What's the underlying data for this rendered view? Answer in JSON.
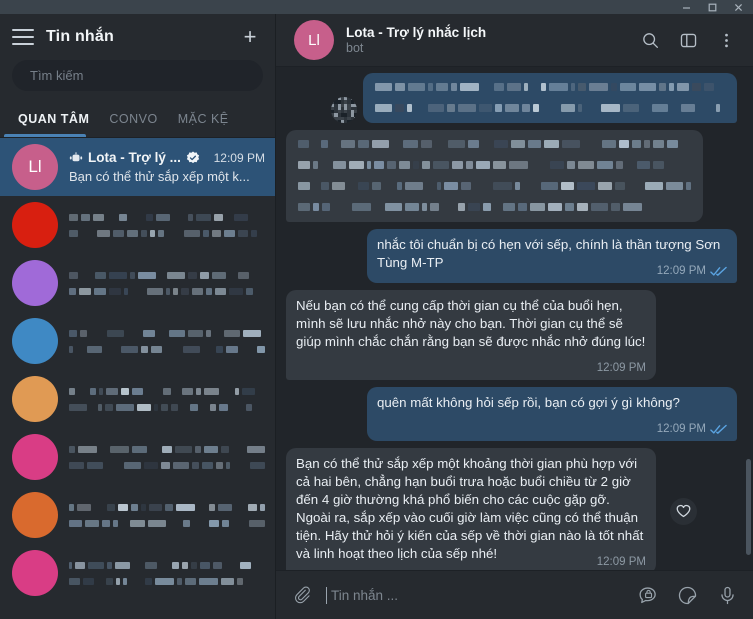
{
  "window": {
    "controls": [
      {
        "name": "minimize",
        "glyph": "minimize-icon"
      },
      {
        "name": "maximize",
        "glyph": "maximize-icon"
      },
      {
        "name": "close",
        "glyph": "close-icon"
      }
    ]
  },
  "colors": {
    "accent_blue": "#4a82b5",
    "selected_row": "#2d5377",
    "bubble_out": "#2d4a66",
    "bubble_in": "#343a41",
    "avatar_pink": "#c75f8b",
    "ticks_blue": "#5aa3e0",
    "sidebar_bg": "#262a2f",
    "chat_bg": "#21252a"
  },
  "sidebar": {
    "menu_icon": "hamburger-icon",
    "title": "Tin nhắn",
    "new_chat_icon": "plus-icon",
    "search": {
      "placeholder": "Tìm kiếm",
      "value": ""
    },
    "tabs": [
      {
        "label": "QUAN TÂM",
        "active": true
      },
      {
        "label": "CONVO",
        "active": false
      },
      {
        "label": "MẶC KỆ",
        "active": false
      }
    ],
    "chats": [
      {
        "selected": true,
        "redacted": false,
        "avatar_initials": "Ll",
        "avatar_color": "#c75f8b",
        "bot_icon": "bot-icon",
        "name": "Lota - Trợ lý ...",
        "verified_icon": "verified-badge-icon",
        "time": "12:09 PM",
        "preview": "Bạn có thể thử sắp xếp một k..."
      },
      {
        "selected": false,
        "redacted": true,
        "avatar_color": "#d81f10",
        "avatar_alt": "#f5b21a"
      },
      {
        "selected": false,
        "redacted": true,
        "avatar_color": "#a06ad8",
        "avatar_alt": "#d9e8f7"
      },
      {
        "selected": false,
        "redacted": true,
        "avatar_color": "#3f89c4",
        "avatar_alt": "#cfe3f2"
      },
      {
        "selected": false,
        "redacted": true,
        "avatar_color": "#e09a54",
        "avatar_alt": "#2a2320"
      },
      {
        "selected": false,
        "redacted": true,
        "avatar_color": "#d93d85",
        "avatar_alt": "#f6c9de"
      },
      {
        "selected": false,
        "redacted": true,
        "avatar_color": "#d96a2e",
        "avatar_alt": "#eef3f8"
      },
      {
        "selected": false,
        "redacted": true,
        "avatar_color": "#d93d85",
        "avatar_alt": "#f6c9de"
      }
    ]
  },
  "chat_header": {
    "avatar_initials": "Ll",
    "title": "Lota - Trợ lý nhắc lịch",
    "subtitle": "bot",
    "actions": [
      {
        "name": "search-icon",
        "label": "Tìm kiếm"
      },
      {
        "name": "toggle-panel-icon",
        "label": "Bảng bên"
      },
      {
        "name": "more-menu-icon",
        "label": "Thêm"
      }
    ]
  },
  "messages": [
    {
      "id": "m1",
      "side": "out",
      "redacted": true,
      "lines": 2,
      "has_avatar": true,
      "text": "",
      "time": ""
    },
    {
      "id": "m2",
      "side": "in",
      "redacted": true,
      "lines": 4,
      "has_avatar": false,
      "text": "",
      "time": ""
    },
    {
      "id": "m3",
      "side": "out",
      "redacted": false,
      "text": "nhắc tôi chuẩn bị có hẹn với sếp, chính là thần tượng Sơn Tùng M-TP",
      "time": "12:09 PM",
      "status_icon": "double-check-icon"
    },
    {
      "id": "m4",
      "side": "in",
      "redacted": false,
      "text": "Nếu bạn có thể cung cấp thời gian cụ thể của buổi hẹn, mình sẽ lưu nhắc nhở này cho bạn. Thời gian cụ thể sẽ giúp mình chắc chắn rằng bạn sẽ được nhắc nhở đúng lúc!",
      "time": "12:09 PM"
    },
    {
      "id": "m5",
      "side": "out",
      "redacted": false,
      "text": "quên mất không hỏi sếp rồi, bạn có gợi ý gì không?",
      "time": "12:09 PM",
      "status_icon": "double-check-icon"
    },
    {
      "id": "m6",
      "side": "in",
      "redacted": false,
      "text": "Bạn có thể thử sắp xếp một khoảng thời gian phù hợp với cả hai bên, chẳng hạn buổi trưa hoặc buổi chiều từ 2 giờ đến 4 giờ thường khá phổ biến cho các cuộc gặp gỡ. Ngoài ra, sắp xếp vào cuối giờ làm việc cũng có thể thuận tiện. Hãy thử hỏi ý kiến của sếp về thời gian nào là tốt nhất và linh hoạt theo lịch của sếp nhé!",
      "time": "12:09 PM",
      "reaction_icon": "heart-icon"
    }
  ],
  "composer": {
    "attach_icon": "paperclip-icon",
    "placeholder": "Tin nhắn ...",
    "value": "",
    "actions": [
      {
        "name": "secret-chat-icon"
      },
      {
        "name": "sticker-icon"
      },
      {
        "name": "microphone-icon"
      }
    ]
  }
}
